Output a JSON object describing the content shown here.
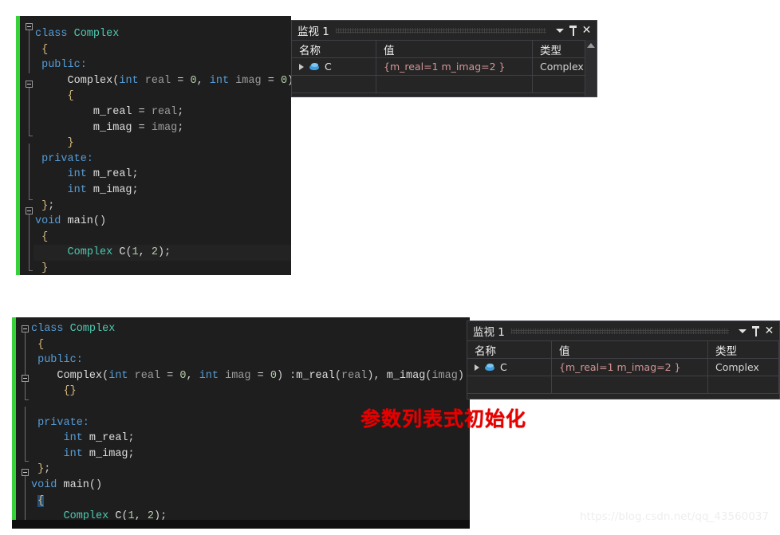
{
  "colors": {
    "editor_bg": "#1e1e1e",
    "changebar_green": "#37d13a",
    "keyword_blue": "#569cd6",
    "type_teal": "#4ec9b0",
    "param_gray": "#9b9b9b",
    "number_green": "#b5cea8",
    "brace_gold": "#d7ba7d",
    "watch_bg": "#252526",
    "watch_value_red": "#d39494",
    "annotation_red": "#e60000"
  },
  "editor_top": {
    "name": "code-editor-pane-top",
    "lines": [
      {
        "tokens": [
          {
            "t": "class ",
            "c": "kw"
          },
          {
            "t": "Complex",
            "c": "type"
          }
        ]
      },
      {
        "tokens": [
          {
            "t": " {",
            "c": "brace"
          }
        ]
      },
      {
        "tokens": [
          {
            "t": " public:",
            "c": "kw"
          }
        ]
      },
      {
        "tokens": [
          {
            "t": "     ",
            "c": "plain"
          },
          {
            "t": "Complex",
            "c": "plain"
          },
          {
            "t": "(",
            "c": "punct"
          },
          {
            "t": "int",
            "c": "kw"
          },
          {
            "t": " real",
            "c": "param"
          },
          {
            "t": " = ",
            "c": "punct"
          },
          {
            "t": "0",
            "c": "num"
          },
          {
            "t": ", ",
            "c": "punct"
          },
          {
            "t": "int",
            "c": "kw"
          },
          {
            "t": " imag",
            "c": "param"
          },
          {
            "t": " = ",
            "c": "punct"
          },
          {
            "t": "0",
            "c": "num"
          },
          {
            "t": ")",
            "c": "punct"
          }
        ]
      },
      {
        "tokens": [
          {
            "t": "     {",
            "c": "brace"
          }
        ]
      },
      {
        "tokens": [
          {
            "t": "         m_real",
            "c": "plain"
          },
          {
            "t": " = ",
            "c": "punct"
          },
          {
            "t": "real",
            "c": "param"
          },
          {
            "t": ";",
            "c": "punct"
          }
        ]
      },
      {
        "tokens": [
          {
            "t": "         m_imag",
            "c": "plain"
          },
          {
            "t": " = ",
            "c": "punct"
          },
          {
            "t": "imag",
            "c": "param"
          },
          {
            "t": ";",
            "c": "punct"
          }
        ]
      },
      {
        "tokens": [
          {
            "t": "     }",
            "c": "brace"
          }
        ]
      },
      {
        "tokens": [
          {
            "t": " private:",
            "c": "kw"
          }
        ]
      },
      {
        "tokens": [
          {
            "t": "     ",
            "c": "plain"
          },
          {
            "t": "int",
            "c": "kw"
          },
          {
            "t": " m_real",
            "c": "plain"
          },
          {
            "t": ";",
            "c": "punct"
          }
        ]
      },
      {
        "tokens": [
          {
            "t": "     ",
            "c": "plain"
          },
          {
            "t": "int",
            "c": "kw"
          },
          {
            "t": " m_imag",
            "c": "plain"
          },
          {
            "t": ";",
            "c": "punct"
          }
        ]
      },
      {
        "tokens": [
          {
            "t": " }",
            "c": "brace"
          },
          {
            "t": ";",
            "c": "punct"
          }
        ]
      },
      {
        "tokens": [
          {
            "t": "void",
            "c": "kw"
          },
          {
            "t": " main",
            "c": "plain"
          },
          {
            "t": "()",
            "c": "punct"
          }
        ]
      },
      {
        "tokens": [
          {
            "t": " {",
            "c": "brace"
          }
        ]
      },
      {
        "current": true,
        "tokens": [
          {
            "t": "     ",
            "c": "plain"
          },
          {
            "t": "Complex",
            "c": "type"
          },
          {
            "t": " C",
            "c": "plain"
          },
          {
            "t": "(",
            "c": "punct"
          },
          {
            "t": "1",
            "c": "num"
          },
          {
            "t": ", ",
            "c": "punct"
          },
          {
            "t": "2",
            "c": "num"
          },
          {
            "t": ")",
            "c": "punct"
          },
          {
            "t": ";",
            "c": "punct"
          }
        ]
      },
      {
        "tokens": [
          {
            "t": " }",
            "c": "brace"
          }
        ]
      }
    ]
  },
  "editor_bottom": {
    "name": "code-editor-pane-bottom",
    "lines": [
      {
        "tokens": [
          {
            "t": "class ",
            "c": "kw"
          },
          {
            "t": "Complex",
            "c": "type"
          }
        ]
      },
      {
        "tokens": [
          {
            "t": " {",
            "c": "brace"
          }
        ]
      },
      {
        "tokens": [
          {
            "t": " public:",
            "c": "kw"
          }
        ]
      },
      {
        "tokens": [
          {
            "t": "    ",
            "c": "plain"
          },
          {
            "t": "Complex",
            "c": "plain"
          },
          {
            "t": "(",
            "c": "punct"
          },
          {
            "t": "int",
            "c": "kw"
          },
          {
            "t": " real",
            "c": "param"
          },
          {
            "t": " = ",
            "c": "punct"
          },
          {
            "t": "0",
            "c": "num"
          },
          {
            "t": ", ",
            "c": "punct"
          },
          {
            "t": "int",
            "c": "kw"
          },
          {
            "t": " imag",
            "c": "param"
          },
          {
            "t": " = ",
            "c": "punct"
          },
          {
            "t": "0",
            "c": "num"
          },
          {
            "t": ")",
            "c": "punct"
          },
          {
            "t": " :",
            "c": "punct"
          },
          {
            "t": "m_real",
            "c": "plain"
          },
          {
            "t": "(",
            "c": "punct"
          },
          {
            "t": "real",
            "c": "param"
          },
          {
            "t": ")",
            "c": "punct"
          },
          {
            "t": ", ",
            "c": "punct"
          },
          {
            "t": "m_imag",
            "c": "plain"
          },
          {
            "t": "(",
            "c": "punct"
          },
          {
            "t": "imag",
            "c": "param"
          },
          {
            "t": ")",
            "c": "punct"
          }
        ]
      },
      {
        "tokens": [
          {
            "t": "     {}",
            "c": "brace"
          }
        ]
      },
      {
        "tokens": [
          {
            "t": "",
            "c": "plain"
          }
        ]
      },
      {
        "tokens": [
          {
            "t": " private:",
            "c": "kw"
          }
        ]
      },
      {
        "tokens": [
          {
            "t": "     ",
            "c": "plain"
          },
          {
            "t": "int",
            "c": "kw"
          },
          {
            "t": " m_real",
            "c": "plain"
          },
          {
            "t": ";",
            "c": "punct"
          }
        ]
      },
      {
        "tokens": [
          {
            "t": "     ",
            "c": "plain"
          },
          {
            "t": "int",
            "c": "kw"
          },
          {
            "t": " m_imag",
            "c": "plain"
          },
          {
            "t": ";",
            "c": "punct"
          }
        ]
      },
      {
        "tokens": [
          {
            "t": " }",
            "c": "brace"
          },
          {
            "t": ";",
            "c": "punct"
          }
        ]
      },
      {
        "tokens": [
          {
            "t": "void",
            "c": "kw"
          },
          {
            "t": " main",
            "c": "plain"
          },
          {
            "t": "()",
            "c": "punct"
          }
        ]
      },
      {
        "tokens": [
          {
            "t": " ",
            "c": "plain"
          },
          {
            "t": "{",
            "c": "brace-hl"
          }
        ]
      },
      {
        "tokens": [
          {
            "t": "     ",
            "c": "plain"
          },
          {
            "t": "Complex",
            "c": "type"
          },
          {
            "t": " C",
            "c": "plain"
          },
          {
            "t": "(",
            "c": "punct"
          },
          {
            "t": "1",
            "c": "num"
          },
          {
            "t": ", ",
            "c": "punct"
          },
          {
            "t": "2",
            "c": "num"
          },
          {
            "t": ")",
            "c": "punct"
          },
          {
            "t": ";",
            "c": "punct"
          }
        ]
      },
      {
        "current": true,
        "tokens": [
          {
            "t": " ",
            "c": "plain"
          },
          {
            "t": "}",
            "c": "brace-hl"
          }
        ]
      }
    ]
  },
  "watch_top": {
    "title": "监视 1",
    "icons": {
      "dropdown": "chevron-down-icon",
      "pin": "pin-icon",
      "close": "close-icon"
    },
    "columns": [
      "名称",
      "值",
      "类型"
    ],
    "rows": [
      {
        "name": "C",
        "value": "{m_real=1 m_imag=2 }",
        "type": "Complex",
        "expandable": true
      }
    ]
  },
  "watch_bottom": {
    "title": "监视 1",
    "icons": {
      "dropdown": "chevron-down-icon",
      "pin": "pin-icon",
      "close": "close-icon"
    },
    "columns": [
      "名称",
      "值",
      "类型"
    ],
    "rows": [
      {
        "name": "C",
        "value": "{m_real=1 m_imag=2 }",
        "type": "Complex",
        "expandable": true
      }
    ]
  },
  "annotation": {
    "text": "参数列表式初始化"
  },
  "watermark": {
    "text": "https://blog.csdn.net/qq_43560037"
  }
}
